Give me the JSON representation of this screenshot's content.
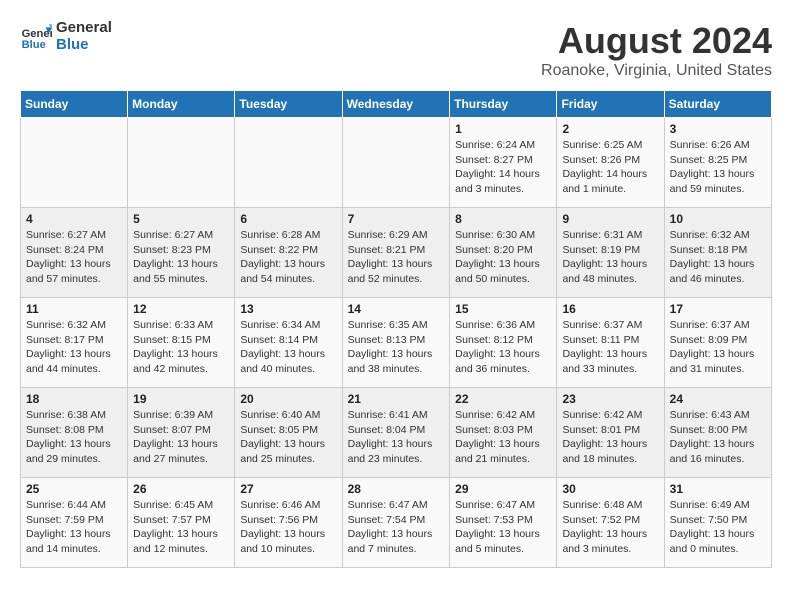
{
  "header": {
    "logo_line1": "General",
    "logo_line2": "Blue",
    "month": "August 2024",
    "location": "Roanoke, Virginia, United States"
  },
  "weekdays": [
    "Sunday",
    "Monday",
    "Tuesday",
    "Wednesday",
    "Thursday",
    "Friday",
    "Saturday"
  ],
  "weeks": [
    [
      {
        "day": "",
        "info": ""
      },
      {
        "day": "",
        "info": ""
      },
      {
        "day": "",
        "info": ""
      },
      {
        "day": "",
        "info": ""
      },
      {
        "day": "1",
        "info": "Sunrise: 6:24 AM\nSunset: 8:27 PM\nDaylight: 14 hours\nand 3 minutes."
      },
      {
        "day": "2",
        "info": "Sunrise: 6:25 AM\nSunset: 8:26 PM\nDaylight: 14 hours\nand 1 minute."
      },
      {
        "day": "3",
        "info": "Sunrise: 6:26 AM\nSunset: 8:25 PM\nDaylight: 13 hours\nand 59 minutes."
      }
    ],
    [
      {
        "day": "4",
        "info": "Sunrise: 6:27 AM\nSunset: 8:24 PM\nDaylight: 13 hours\nand 57 minutes."
      },
      {
        "day": "5",
        "info": "Sunrise: 6:27 AM\nSunset: 8:23 PM\nDaylight: 13 hours\nand 55 minutes."
      },
      {
        "day": "6",
        "info": "Sunrise: 6:28 AM\nSunset: 8:22 PM\nDaylight: 13 hours\nand 54 minutes."
      },
      {
        "day": "7",
        "info": "Sunrise: 6:29 AM\nSunset: 8:21 PM\nDaylight: 13 hours\nand 52 minutes."
      },
      {
        "day": "8",
        "info": "Sunrise: 6:30 AM\nSunset: 8:20 PM\nDaylight: 13 hours\nand 50 minutes."
      },
      {
        "day": "9",
        "info": "Sunrise: 6:31 AM\nSunset: 8:19 PM\nDaylight: 13 hours\nand 48 minutes."
      },
      {
        "day": "10",
        "info": "Sunrise: 6:32 AM\nSunset: 8:18 PM\nDaylight: 13 hours\nand 46 minutes."
      }
    ],
    [
      {
        "day": "11",
        "info": "Sunrise: 6:32 AM\nSunset: 8:17 PM\nDaylight: 13 hours\nand 44 minutes."
      },
      {
        "day": "12",
        "info": "Sunrise: 6:33 AM\nSunset: 8:15 PM\nDaylight: 13 hours\nand 42 minutes."
      },
      {
        "day": "13",
        "info": "Sunrise: 6:34 AM\nSunset: 8:14 PM\nDaylight: 13 hours\nand 40 minutes."
      },
      {
        "day": "14",
        "info": "Sunrise: 6:35 AM\nSunset: 8:13 PM\nDaylight: 13 hours\nand 38 minutes."
      },
      {
        "day": "15",
        "info": "Sunrise: 6:36 AM\nSunset: 8:12 PM\nDaylight: 13 hours\nand 36 minutes."
      },
      {
        "day": "16",
        "info": "Sunrise: 6:37 AM\nSunset: 8:11 PM\nDaylight: 13 hours\nand 33 minutes."
      },
      {
        "day": "17",
        "info": "Sunrise: 6:37 AM\nSunset: 8:09 PM\nDaylight: 13 hours\nand 31 minutes."
      }
    ],
    [
      {
        "day": "18",
        "info": "Sunrise: 6:38 AM\nSunset: 8:08 PM\nDaylight: 13 hours\nand 29 minutes."
      },
      {
        "day": "19",
        "info": "Sunrise: 6:39 AM\nSunset: 8:07 PM\nDaylight: 13 hours\nand 27 minutes."
      },
      {
        "day": "20",
        "info": "Sunrise: 6:40 AM\nSunset: 8:05 PM\nDaylight: 13 hours\nand 25 minutes."
      },
      {
        "day": "21",
        "info": "Sunrise: 6:41 AM\nSunset: 8:04 PM\nDaylight: 13 hours\nand 23 minutes."
      },
      {
        "day": "22",
        "info": "Sunrise: 6:42 AM\nSunset: 8:03 PM\nDaylight: 13 hours\nand 21 minutes."
      },
      {
        "day": "23",
        "info": "Sunrise: 6:42 AM\nSunset: 8:01 PM\nDaylight: 13 hours\nand 18 minutes."
      },
      {
        "day": "24",
        "info": "Sunrise: 6:43 AM\nSunset: 8:00 PM\nDaylight: 13 hours\nand 16 minutes."
      }
    ],
    [
      {
        "day": "25",
        "info": "Sunrise: 6:44 AM\nSunset: 7:59 PM\nDaylight: 13 hours\nand 14 minutes."
      },
      {
        "day": "26",
        "info": "Sunrise: 6:45 AM\nSunset: 7:57 PM\nDaylight: 13 hours\nand 12 minutes."
      },
      {
        "day": "27",
        "info": "Sunrise: 6:46 AM\nSunset: 7:56 PM\nDaylight: 13 hours\nand 10 minutes."
      },
      {
        "day": "28",
        "info": "Sunrise: 6:47 AM\nSunset: 7:54 PM\nDaylight: 13 hours\nand 7 minutes."
      },
      {
        "day": "29",
        "info": "Sunrise: 6:47 AM\nSunset: 7:53 PM\nDaylight: 13 hours\nand 5 minutes."
      },
      {
        "day": "30",
        "info": "Sunrise: 6:48 AM\nSunset: 7:52 PM\nDaylight: 13 hours\nand 3 minutes."
      },
      {
        "day": "31",
        "info": "Sunrise: 6:49 AM\nSunset: 7:50 PM\nDaylight: 13 hours\nand 0 minutes."
      }
    ]
  ]
}
